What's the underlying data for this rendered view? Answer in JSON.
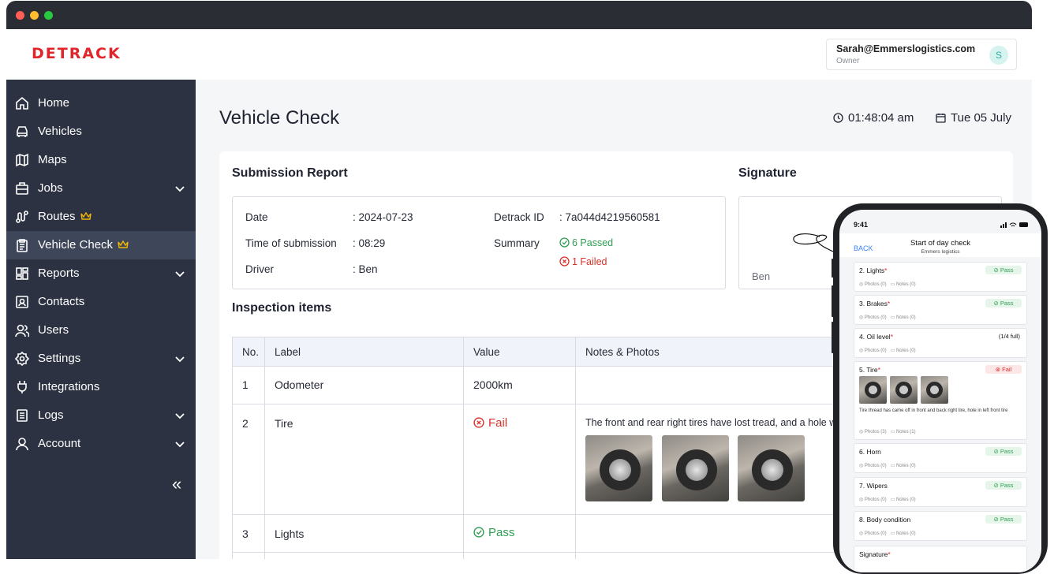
{
  "app": {
    "logo": "DETRACK"
  },
  "user": {
    "email": "Sarah@Emmerslogistics.com",
    "role": "Owner",
    "initial": "S"
  },
  "sidebar": {
    "items": [
      {
        "label": "Home",
        "icon": "home-icon"
      },
      {
        "label": "Vehicles",
        "icon": "car-icon"
      },
      {
        "label": "Maps",
        "icon": "map-icon"
      },
      {
        "label": "Jobs",
        "icon": "briefcase-icon",
        "expandable": true
      },
      {
        "label": "Routes",
        "icon": "route-icon",
        "premium": true
      },
      {
        "label": "Vehicle Check",
        "icon": "clipboard-icon",
        "premium": true,
        "active": true
      },
      {
        "label": "Reports",
        "icon": "reports-icon",
        "expandable": true
      },
      {
        "label": "Contacts",
        "icon": "contacts-icon"
      },
      {
        "label": "Users",
        "icon": "users-icon"
      },
      {
        "label": "Settings",
        "icon": "settings-icon",
        "expandable": true
      },
      {
        "label": "Integrations",
        "icon": "plug-icon"
      },
      {
        "label": "Logs",
        "icon": "logs-icon",
        "expandable": true
      },
      {
        "label": "Account",
        "icon": "account-icon",
        "expandable": true
      }
    ],
    "collapse_glyph": "«"
  },
  "page": {
    "title": "Vehicle Check",
    "time": "01:48:04 am",
    "date": "Tue 05 July"
  },
  "report": {
    "title": "Submission Report",
    "date_label": "Date",
    "date_value": ": 2024-07-23",
    "time_label": "Time of submission",
    "time_value": ": 08:29",
    "driver_label": "Driver",
    "driver_value": ": Ben",
    "detrack_id_label": "Detrack ID",
    "detrack_id_value": ": 7a044d4219560581",
    "summary_label": "Summary",
    "passed": "6 Passed",
    "failed": "1 Failed"
  },
  "signature": {
    "title": "Signature",
    "name": "Ben"
  },
  "inspection": {
    "title": "Inspection items",
    "headers": [
      "No.",
      "Label",
      "Value",
      "Notes & Photos"
    ],
    "rows": [
      {
        "no": "1",
        "label": "Odometer",
        "value": "2000km",
        "status": "",
        "note": ""
      },
      {
        "no": "2",
        "label": "Tire",
        "value": "Fail",
        "status": "fail",
        "note": "The front and rear right tires have lost tread, and a hole was"
      },
      {
        "no": "3",
        "label": "Lights",
        "value": "Pass",
        "status": "pass",
        "note": ""
      }
    ]
  },
  "phone": {
    "status_time": "9:41",
    "back": "BACK",
    "title": "Start of day check",
    "subtitle": "Emmers logistics",
    "items": [
      {
        "name": "2. Lights",
        "badge": "Pass",
        "status": "pass",
        "photos": "Photos (0)",
        "notes": "Notes (0)"
      },
      {
        "name": "3. Brakes",
        "badge": "Pass",
        "status": "pass",
        "photos": "Photos (0)",
        "notes": "Notes (0)"
      },
      {
        "name": "4. Oil level",
        "badge": "(1/4 full)",
        "status": "value",
        "photos": "Photos (0)",
        "notes": "Notes (0)"
      },
      {
        "name": "5. Tire",
        "badge": "Fail",
        "status": "fail",
        "photos": "Photos (3)",
        "notes": "Notes (1)",
        "note_text": "Tire thread has came off in front and back right tire, hole in left front tire"
      },
      {
        "name": "6. Horn",
        "badge": "Pass",
        "status": "pass",
        "photos": "Photos (0)",
        "notes": "Notes (0)"
      },
      {
        "name": "7. Wipers",
        "badge": "Pass",
        "status": "pass",
        "photos": "Photos (0)",
        "notes": "Notes (0)"
      },
      {
        "name": "8. Body condition",
        "badge": "Pass",
        "status": "pass",
        "photos": "Photos (0)",
        "notes": "Notes (0)"
      }
    ],
    "signature_label": "Signature"
  },
  "colors": {
    "brand": "#e0262b",
    "sidebar": "#2c3242",
    "sidebar_active": "#3e4659",
    "pass": "#2f9e52",
    "fail": "#d9322b",
    "premium": "#f2b705"
  }
}
